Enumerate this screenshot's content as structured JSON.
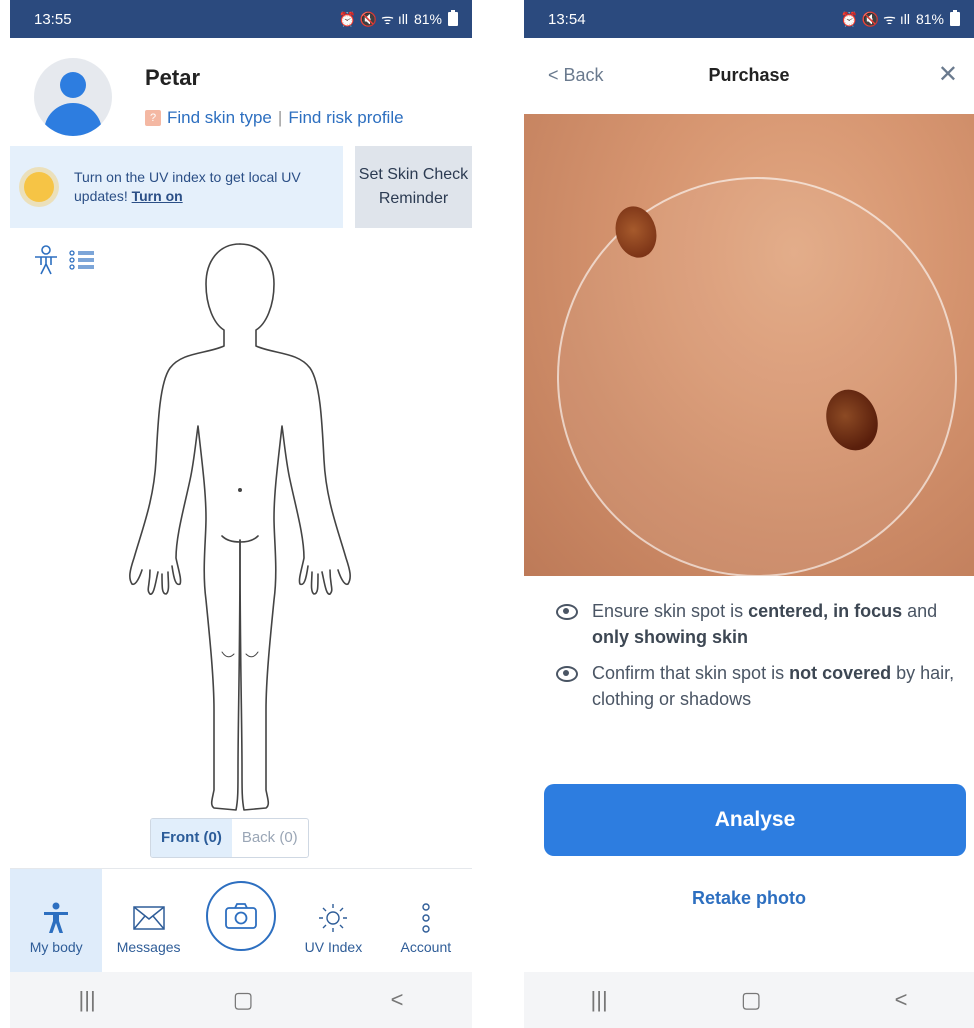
{
  "screen1": {
    "status": {
      "time": "13:55",
      "battery": "81%"
    },
    "profile": {
      "name": "Petar",
      "find_skin_type": "Find skin type",
      "separator": "|",
      "find_risk_profile": "Find risk profile"
    },
    "uv_banner": {
      "text": "Turn on the UV index to get local UV updates!",
      "link": "Turn on"
    },
    "reminder_button": "Set Skin Check Reminder",
    "segments": {
      "front": "Front (0)",
      "back": "Back (0)"
    },
    "tabs": [
      {
        "label": "My body",
        "icon": "person-icon"
      },
      {
        "label": "Messages",
        "icon": "envelope-icon"
      },
      {
        "label": "",
        "icon": "camera-icon"
      },
      {
        "label": "UV Index",
        "icon": "sun-icon"
      },
      {
        "label": "Account",
        "icon": "dots-vertical-icon"
      }
    ]
  },
  "screen2": {
    "status": {
      "time": "13:54",
      "battery": "81%"
    },
    "back_label": "Back",
    "title": "Purchase",
    "tips": [
      {
        "pre": "Ensure skin spot is ",
        "b1": "centered, in focus",
        "mid": " and ",
        "b2": "only showing skin",
        "post": ""
      },
      {
        "pre": "Confirm that skin spot is ",
        "b1": "not covered",
        "mid": " by hair, clothing or shadows",
        "b2": "",
        "post": ""
      }
    ],
    "analyse_button": "Analyse",
    "retake_link": "Retake photo"
  },
  "colors": {
    "accent": "#2d7de0",
    "statusbar": "#2b4a7e",
    "banner_bg": "#e5f0fb"
  }
}
